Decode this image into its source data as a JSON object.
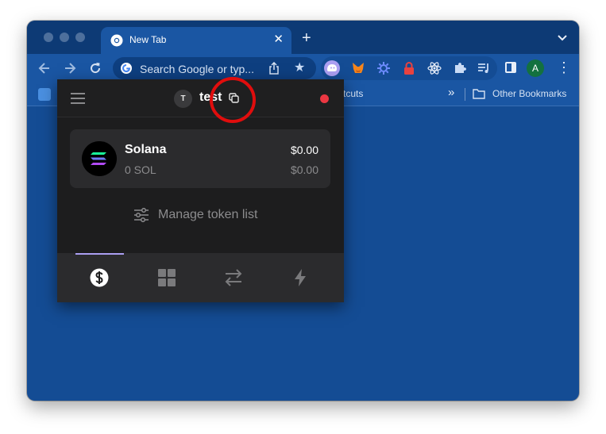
{
  "browser": {
    "tab_title": "New Tab",
    "omnibox_placeholder": "Search Google or typ...",
    "profile_initial": "A",
    "bookmarks_partial": "tcuts",
    "other_bookmarks": "Other Bookmarks",
    "extensions": [
      "phantom-icon",
      "metamask-icon",
      "settings-extension-icon",
      "lock-extension-icon",
      "react-icon",
      "puzzle-icon",
      "media-icon"
    ]
  },
  "wallet": {
    "account_initial": "T",
    "account_name": "test",
    "status_color": "#eb3742",
    "token": {
      "name": "Solana",
      "quantity": "0 SOL",
      "value": "$0.00",
      "change": "$0.00"
    },
    "manage_label": "Manage token list",
    "nav_tabs": [
      "tokens",
      "collectibles",
      "swap",
      "activity"
    ],
    "active_tab": "tokens"
  },
  "annotation": {
    "highlight_color": "#e00d0d",
    "target": "copy-address-icon"
  }
}
